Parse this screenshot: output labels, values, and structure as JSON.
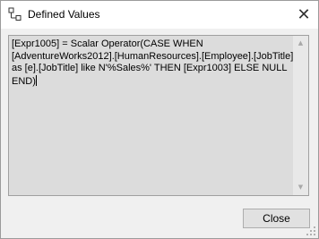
{
  "window": {
    "title": "Defined Values",
    "close_glyph": "✕"
  },
  "textbox": {
    "value": "[Expr1005] = Scalar Operator(CASE WHEN [AdventureWorks2012].[HumanResources].[Employee].[JobTitle] as [e].[JobTitle] like N'%Sales%' THEN [Expr1003] ELSE NULL END)"
  },
  "scrollbar": {
    "up_glyph": "▲",
    "down_glyph": "▼"
  },
  "buttons": {
    "close_label": "Close"
  },
  "icons": {
    "app": "defined-values-icon",
    "close": "close-icon",
    "grip": "resize-grip-icon"
  }
}
